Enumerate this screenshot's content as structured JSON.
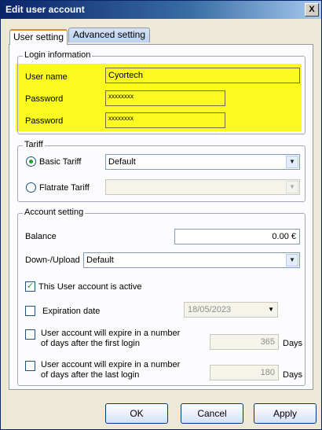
{
  "window": {
    "title": "Edit user account",
    "close_glyph": "X"
  },
  "tabs": [
    {
      "label": "User setting",
      "active": true
    },
    {
      "label": "Advanced setting",
      "active": false
    }
  ],
  "login": {
    "legend": "Login information",
    "highlight_color": "#fbfa20",
    "username_label": "User name",
    "username_value": "Cyortech",
    "password_label": "Password",
    "password_value": "xxxxxxxx",
    "password2_label": "Password",
    "password2_value": "xxxxxxxx"
  },
  "tariff": {
    "legend": "Tariff",
    "basic_label": "Basic Tariff",
    "basic_selected": true,
    "basic_value": "Default",
    "flatrate_label": "Flatrate Tariff",
    "flatrate_value": ""
  },
  "account": {
    "legend": "Account setting",
    "balance_label": "Balance",
    "balance_value": "0.00 €",
    "updown_label": "Down-/Upload",
    "updown_value": "Default",
    "active_label": "This User account is active",
    "active_checked": true,
    "expiration_label": "Expiration date",
    "expiration_date": "18/05/2023",
    "expire_first_line1": "User account will expire in a  number",
    "expire_first_line2": "of days after the first login",
    "expire_first_value": "365",
    "expire_first_unit": "Days",
    "expire_last_line1": "User account will expire in a  number",
    "expire_last_line2": "of days after the last login",
    "expire_last_value": "180",
    "expire_last_unit": "Days"
  },
  "buttons": {
    "ok": "OK",
    "cancel": "Cancel",
    "apply": "Apply"
  },
  "icons": {
    "dropdown": "chevron-down-icon",
    "check": "checkmark-icon"
  }
}
